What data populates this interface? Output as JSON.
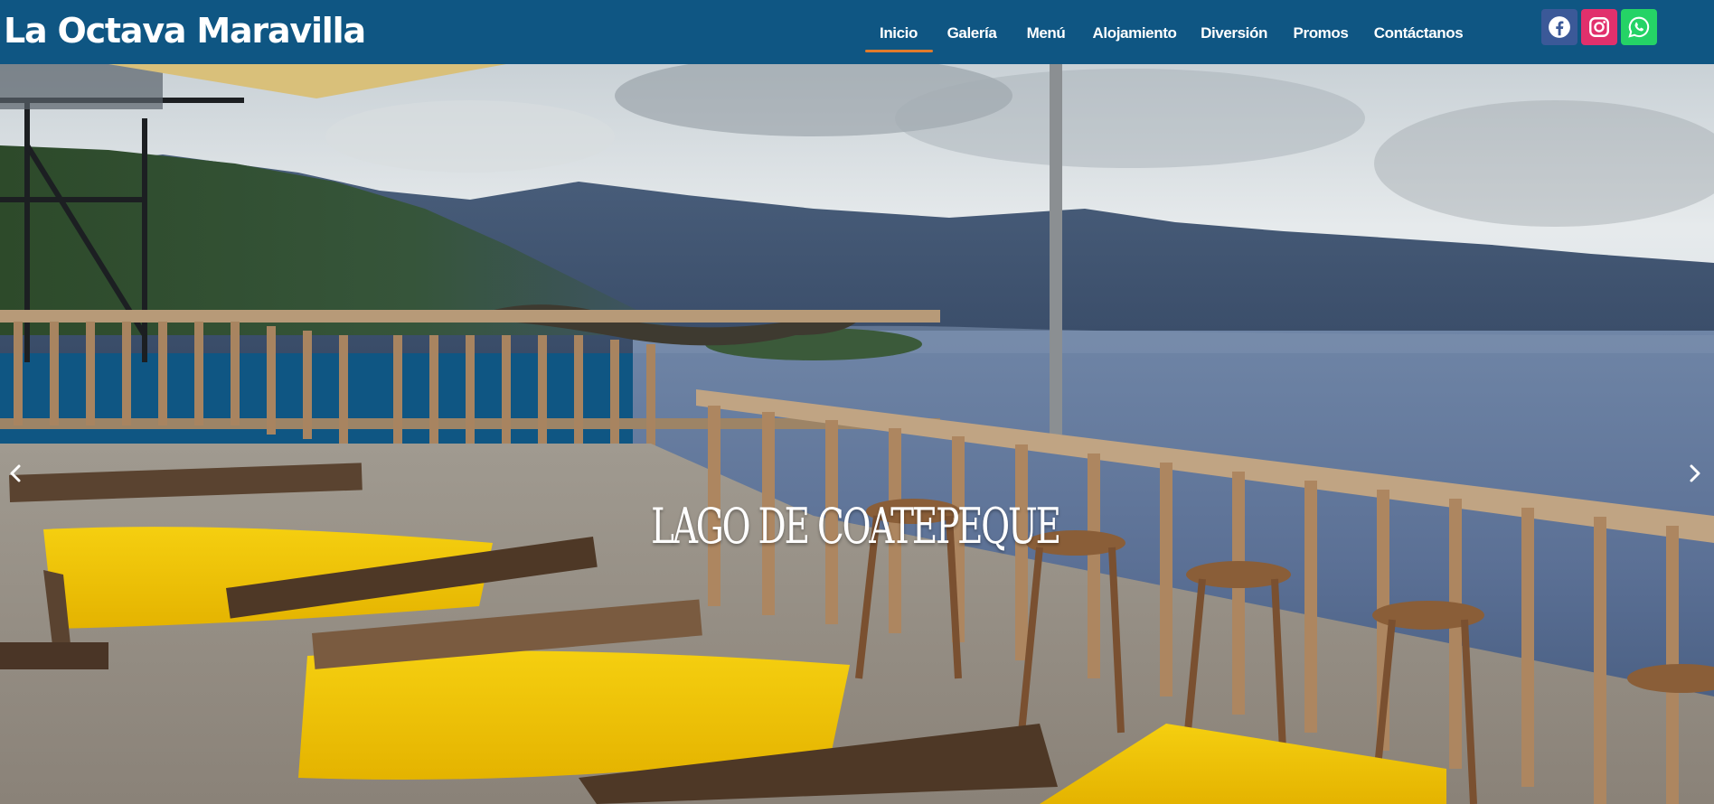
{
  "site": {
    "title": "La Octava Maravilla"
  },
  "nav": {
    "items": [
      {
        "label": "Inicio",
        "active": true
      },
      {
        "label": "Galería"
      },
      {
        "label": "Menú"
      },
      {
        "label": "Alojamiento"
      },
      {
        "label": "Diversión"
      },
      {
        "label": "Promos"
      },
      {
        "label": "Contáctanos"
      }
    ]
  },
  "social": {
    "icons": [
      "facebook-icon",
      "instagram-icon",
      "whatsapp-icon"
    ],
    "colors": {
      "facebook": "#3b5998",
      "instagram": "#e1306c",
      "whatsapp": "#25d366"
    }
  },
  "slider": {
    "caption": "LAGO DE COATEPEQUE",
    "prev_icon": "chevron-left-icon",
    "next_icon": "chevron-right-icon"
  },
  "colors": {
    "header_bg": "#0f5683",
    "active_underline": "#e07b2c"
  }
}
